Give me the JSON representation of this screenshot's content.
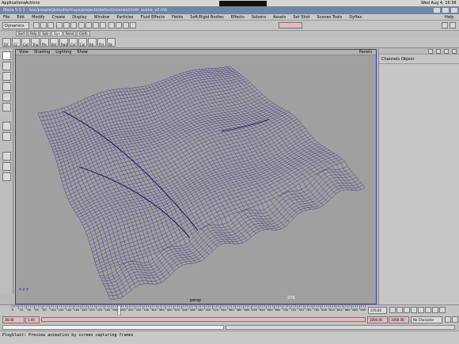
{
  "system": {
    "apps": "Applications",
    "actions": "Actions",
    "clock": "Wed Aug 4, 16:38"
  },
  "window": {
    "title": "Maya 5.0.1 : /usr/people/jkstudio/maya/projects/default/scenes/cloth_scene_v2.mb"
  },
  "menus": [
    "File",
    "Edit",
    "Modify",
    "Create",
    "Display",
    "Window",
    "Particles",
    "Fluid Effects",
    "Fields",
    "Soft/Rigid Bodies",
    "Effects",
    "Solvers",
    "Assets",
    "Set Shot",
    "Scenes Tools",
    "Dyflex"
  ],
  "help": "Help",
  "mode": "Dynamics",
  "shelf_tabs": [
    "Surf",
    "Poly",
    "Sub",
    "Dyn",
    "Rend",
    "Cloth"
  ],
  "shelf_active": 3,
  "shelf_items": [
    "SV",
    "CC",
    "Cut",
    "Trip",
    "Pln",
    "Bst",
    "Rgd",
    "Cst",
    "Col",
    "Bd",
    "Fld",
    "Bk"
  ],
  "viewport": {
    "menus": [
      "View",
      "Shading",
      "Lighting",
      "Show"
    ],
    "panels": "Panels",
    "camera": "persp",
    "frame_label": "276",
    "axis": "x y z"
  },
  "channels": {
    "tab1": "Channels",
    "tab2": "Object"
  },
  "timeline": {
    "ticks": [
      "0",
      "20",
      "40",
      "60",
      "80",
      "100",
      "120",
      "140",
      "160",
      "180",
      "200",
      "220",
      "240",
      "260",
      "280",
      "300",
      "320",
      "340",
      "360",
      "380",
      "400",
      "420",
      "440",
      "460",
      "480",
      "500",
      "520",
      "540",
      "560",
      "580",
      "600",
      "620",
      "640",
      "660",
      "680",
      "700",
      "720",
      "740",
      "760",
      "780",
      "800",
      "820",
      "840",
      "860",
      "880",
      "900"
    ],
    "current": "276",
    "current_time": "376.00"
  },
  "range": {
    "start": "36.00",
    "start2": "1.00",
    "end": "1000.00",
    "end2": "1000.00",
    "character": "No Character Set"
  },
  "help_line": "Playblast: Preview animation by screen capturing frames",
  "colors": {
    "title": "#6e86a8",
    "mesh": "#1c1a84",
    "viewport": "#a0a0a0",
    "range": "#e7b9bd"
  }
}
